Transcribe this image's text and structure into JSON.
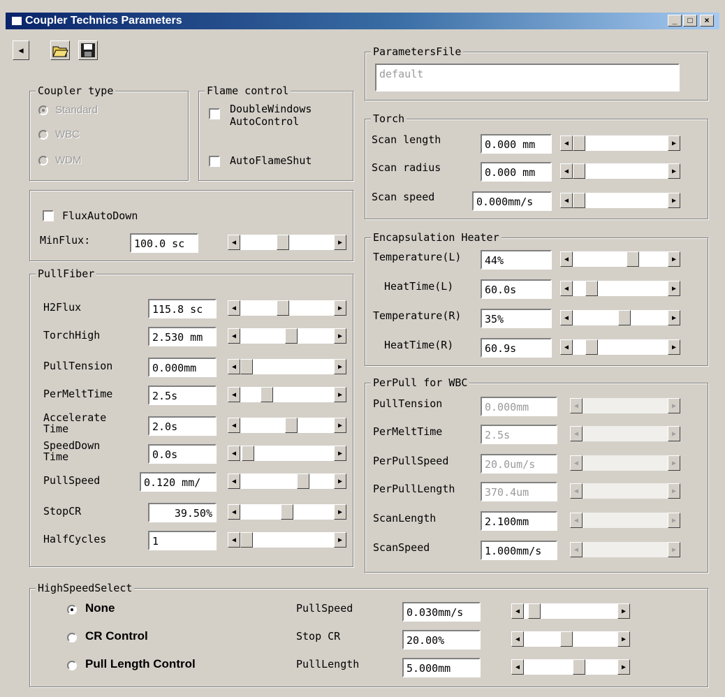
{
  "window": {
    "title": "Coupler Technics Parameters",
    "min": "_",
    "max": "□",
    "close": "×"
  },
  "toolbar": {
    "back": "◀"
  },
  "parameters_file": {
    "legend": "ParametersFile",
    "value": "default"
  },
  "coupler_type": {
    "legend": "Coupler type",
    "options": [
      {
        "label": "Standard",
        "selected": true
      },
      {
        "label": "WBC",
        "selected": false
      },
      {
        "label": "WDM",
        "selected": false
      }
    ]
  },
  "flame_control": {
    "legend": "Flame control",
    "double_windows_line1": "DoubleWindows",
    "double_windows_line2": "AutoControl",
    "auto_flame_shut": "AutoFlameShut"
  },
  "flux": {
    "flux_auto_down": "FluxAutoDown",
    "min_flux_label": "MinFlux:",
    "min_flux_value": "100.0 sc",
    "min_flux_level": 0.45
  },
  "pull_fiber": {
    "legend": "PullFiber",
    "rows": [
      {
        "label": "H2Flux",
        "value": "115.8 sc",
        "level": 0.45
      },
      {
        "label": "TorchHigh",
        "value": "2.530 mm",
        "level": 0.55
      },
      {
        "label": "PullTension",
        "value": "0.000mm",
        "level": 0.0
      },
      {
        "label": "PerMeltTime",
        "value": "2.5s",
        "level": 0.25
      },
      {
        "label1": "Accelerate",
        "label2": "Time",
        "value": "2.0s",
        "level": 0.55
      },
      {
        "label1": "SpeedDown",
        "label2": "Time",
        "value": "0.0s",
        "level": 0.02
      },
      {
        "label": "PullSpeed",
        "value": "0.120 mm/",
        "level": 0.7
      },
      {
        "label": "StopCR",
        "value": "39.50%",
        "level": 0.5
      },
      {
        "label": "HalfCycles",
        "value": "1",
        "level": 0.0
      }
    ]
  },
  "torch": {
    "legend": "Torch",
    "rows": [
      {
        "label": "Scan length",
        "value": "0.000 mm",
        "level": 0.0
      },
      {
        "label": "Scan radius",
        "value": "0.000 mm",
        "level": 0.0
      },
      {
        "label": "Scan speed",
        "value": "0.000mm/s",
        "level": 0.0
      }
    ]
  },
  "encapsulation_heater": {
    "legend": "Encapsulation Heater",
    "rows": [
      {
        "label": "Temperature(L)",
        "value": "44%",
        "level": 0.65
      },
      {
        "label": "HeatTime(L)",
        "value": "60.0s",
        "level": 0.15
      },
      {
        "label": "Temperature(R)",
        "value": "35%",
        "level": 0.55
      },
      {
        "label": "HeatTime(R)",
        "value": "60.9s",
        "level": 0.15
      }
    ]
  },
  "per_pull_wbc": {
    "legend": "PerPull for WBC",
    "rows": [
      {
        "label": "PullTension",
        "value": "0.000mm",
        "disabled": true
      },
      {
        "label": "PerMeltTime",
        "value": "2.5s",
        "disabled": true
      },
      {
        "label": "PerPullSpeed",
        "value": "20.0um/s",
        "disabled": true
      },
      {
        "label": "PerPullLength",
        "value": "370.4um",
        "disabled": true
      },
      {
        "label": "ScanLength",
        "value": "2.100mm",
        "disabled": false
      },
      {
        "label": "ScanSpeed",
        "value": "1.000mm/s",
        "disabled": false
      }
    ]
  },
  "high_speed_select": {
    "legend": "HighSpeedSelect",
    "options": [
      {
        "label": "None",
        "selected": true
      },
      {
        "label": "CR Control",
        "selected": false
      },
      {
        "label": "Pull Length Control",
        "selected": false
      }
    ],
    "rows": [
      {
        "label": "PullSpeed",
        "value": "0.030mm/s",
        "level": 0.05
      },
      {
        "label": "Stop CR",
        "value": "20.00%",
        "level": 0.45
      },
      {
        "label": "PullLength",
        "value": "5.000mm",
        "level": 0.6
      }
    ]
  }
}
